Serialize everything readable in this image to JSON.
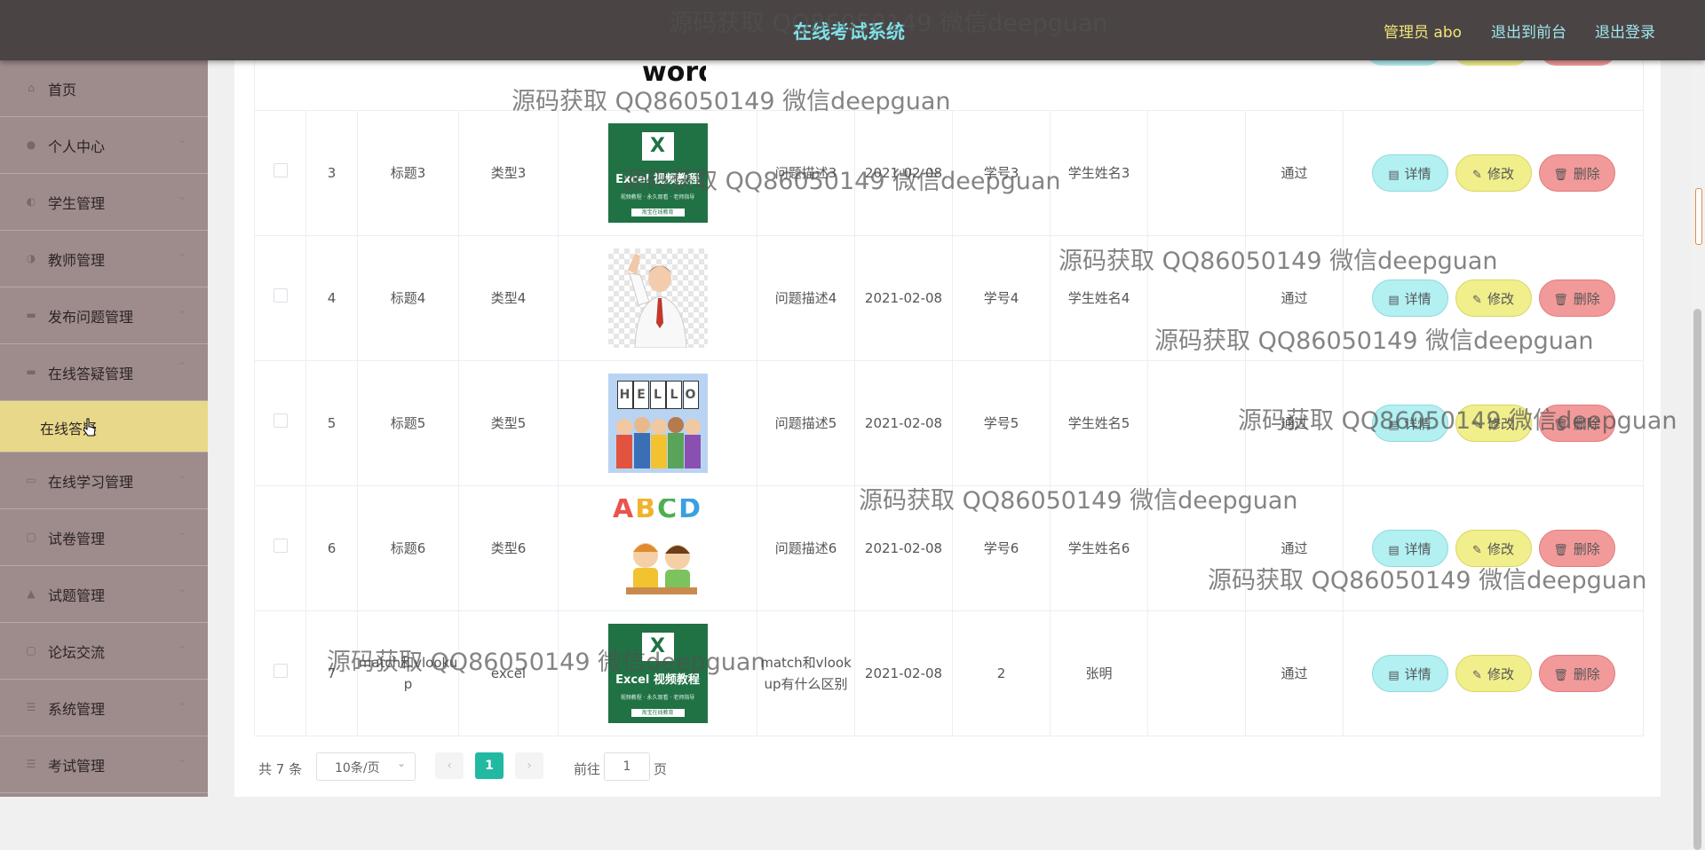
{
  "header": {
    "title": "在线考试系统",
    "user": "管理员 abo",
    "front_link": "退出到前台",
    "logout_link": "退出登录"
  },
  "sidebar": {
    "items": [
      {
        "label": "首页",
        "icon": "home-icon"
      },
      {
        "label": "个人中心",
        "icon": "user-icon"
      },
      {
        "label": "学生管理",
        "icon": "student-icon"
      },
      {
        "label": "教师管理",
        "icon": "teacher-icon"
      },
      {
        "label": "发布问题管理",
        "icon": "question-icon"
      },
      {
        "label": "在线答疑管理",
        "icon": "answer-icon"
      },
      {
        "label": "在线答疑",
        "icon": ""
      },
      {
        "label": "在线学习管理",
        "icon": "study-icon"
      },
      {
        "label": "试卷管理",
        "icon": "paper-icon"
      },
      {
        "label": "试题管理",
        "icon": "exam-question-icon"
      },
      {
        "label": "论坛交流",
        "icon": "forum-icon"
      },
      {
        "label": "系统管理",
        "icon": "system-icon"
      },
      {
        "label": "考试管理",
        "icon": "exam-icon"
      }
    ]
  },
  "partial_top_image_text": "words",
  "table": {
    "rows": [
      {
        "index": "3",
        "title": "标题3",
        "type": "类型3",
        "image": "excel-thumbnail",
        "desc": "问题描述3",
        "date": "2021-02-08",
        "student_no": "学号3",
        "student_name": "学生姓名3",
        "reply": "",
        "status": "通过"
      },
      {
        "index": "4",
        "title": "标题4",
        "type": "类型4",
        "image": "teacher-photo-thumbnail",
        "desc": "问题描述4",
        "date": "2021-02-08",
        "student_no": "学号4",
        "student_name": "学生姓名4",
        "reply": "",
        "status": "通过"
      },
      {
        "index": "5",
        "title": "标题5",
        "type": "类型5",
        "image": "hello-kids-thumbnail",
        "desc": "问题描述5",
        "date": "2021-02-08",
        "student_no": "学号5",
        "student_name": "学生姓名5",
        "reply": "",
        "status": "通过"
      },
      {
        "index": "6",
        "title": "标题6",
        "type": "类型6",
        "image": "abcd-kids-thumbnail",
        "desc": "问题描述6",
        "date": "2021-02-08",
        "student_no": "学号6",
        "student_name": "学生姓名6",
        "reply": "",
        "status": "通过"
      },
      {
        "index": "7",
        "title": "match和vlookup",
        "type": "excel",
        "image": "excel-thumbnail",
        "desc": "match和vlookup有什么区别",
        "date": "2021-02-08",
        "student_no": "2",
        "student_name": "张明",
        "reply": "",
        "status": "通过"
      }
    ],
    "actions": {
      "detail": "详情",
      "edit": "修改",
      "delete": "删除"
    }
  },
  "excel_thumb": {
    "big": "X",
    "title": "Excel 视频教程",
    "sub": "视频教程 · 永久观看 · 老师指导",
    "footer": "淘宝在线教育"
  },
  "hello_thumb": {
    "letters": [
      "H",
      "E",
      "L",
      "L",
      "O"
    ]
  },
  "abcd_thumb": {
    "letters": [
      "A",
      "B",
      "C",
      "D"
    ]
  },
  "pagination": {
    "total": "共 7 条",
    "page_size": "10条/页",
    "current_page": "1",
    "goto_label": "前往",
    "goto_value": "1",
    "goto_unit": "页"
  },
  "watermark": "源码获取 QQ86050149 微信deepguan",
  "colors": {
    "header_bg": "#4a4444",
    "sidebar_bg": "#9e8b8b",
    "active_item": "#e8d98a",
    "detail_btn": "#b2f0f2",
    "edit_btn": "#f1ef8c",
    "delete_btn": "#f29a9a",
    "page_active": "#22b9a3"
  }
}
